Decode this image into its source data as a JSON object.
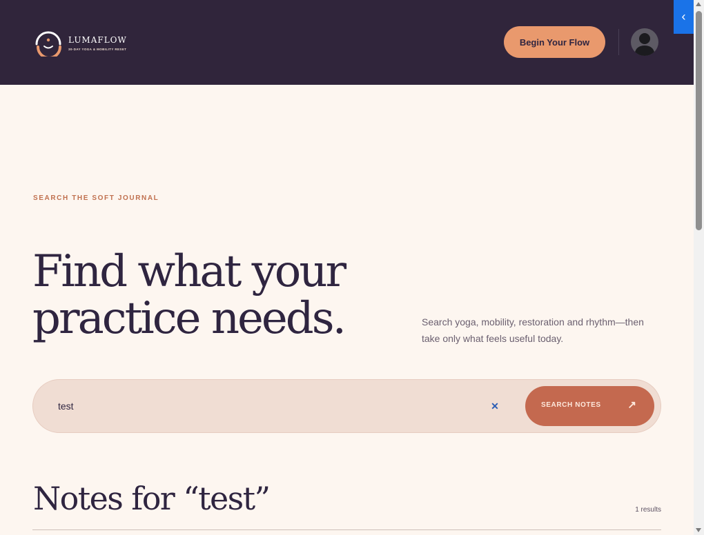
{
  "header": {
    "brand_name": "LUMAFLOW",
    "brand_tagline": "30-DAY YOGA & MOBILITY RESET",
    "cta_label": "Begin Your Flow",
    "background": "#30253b",
    "cta_color": "#e9996d"
  },
  "side_panel": {
    "toggle_icon": "chevron-left-icon",
    "toggle_glyph": "‹"
  },
  "hero": {
    "eyebrow": "SEARCH THE SOFT JOURNAL",
    "headline_line1": "Find what your",
    "headline_line2": "practice needs.",
    "subcopy": "Search yoga, mobility, restoration and rhythm—then take only what feels useful today."
  },
  "search": {
    "value": "test",
    "clear_glyph": "✕",
    "button_label": "SEARCH NOTES",
    "button_glyph": "↗",
    "button_color": "#c4694f"
  },
  "results": {
    "title": "Notes for “test”",
    "count": "1 results"
  }
}
